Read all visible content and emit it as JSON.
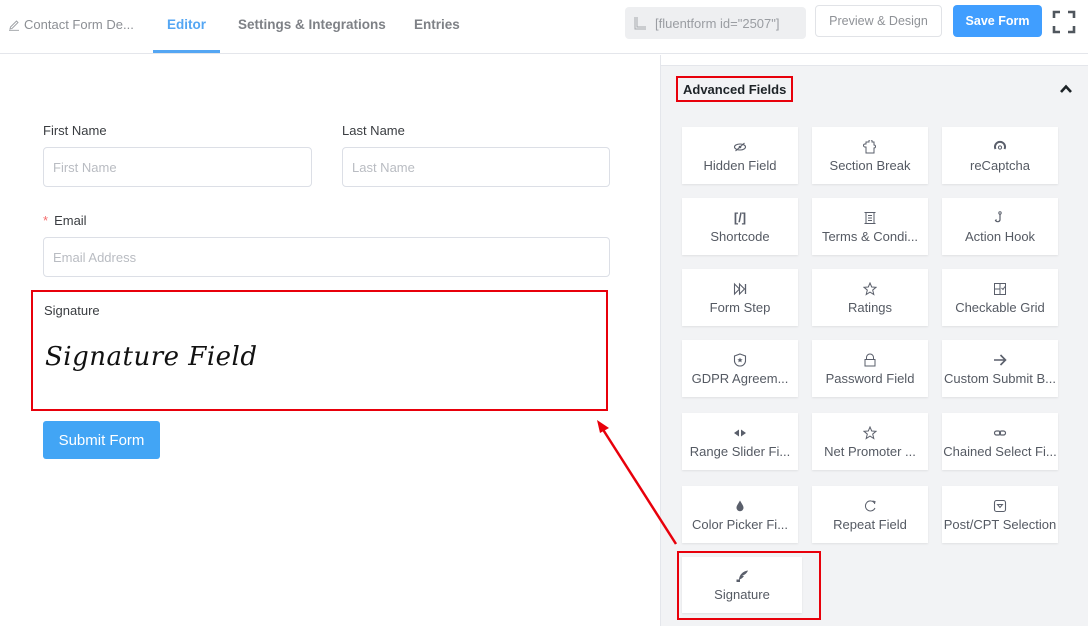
{
  "header": {
    "form_title": "Contact Form De...",
    "tabs": [
      {
        "label": "Editor",
        "active": true
      },
      {
        "label": "Settings & Integrations",
        "active": false
      },
      {
        "label": "Entries",
        "active": false
      }
    ],
    "shortcode": "[fluentform id=\"2507\"]",
    "preview_label": "Preview & Design",
    "save_label": "Save Form"
  },
  "form": {
    "first_name": {
      "label": "First Name",
      "placeholder": "First Name"
    },
    "last_name": {
      "label": "Last Name",
      "placeholder": "Last Name"
    },
    "email": {
      "required_mark": "*",
      "label": "Email",
      "placeholder": "Email Address"
    },
    "signature": {
      "label": "Signature",
      "preview_text": "Signature Field"
    },
    "submit_label": "Submit Form"
  },
  "sidebar": {
    "section_title": "Advanced Fields",
    "fields": [
      {
        "label": "Hidden Field",
        "icon": "eye-slash-icon"
      },
      {
        "label": "Section Break",
        "icon": "puzzle-icon"
      },
      {
        "label": "reCaptcha",
        "icon": "recaptcha-icon"
      },
      {
        "label": "Shortcode",
        "icon": "shortcode-icon"
      },
      {
        "label": "Terms & Condi...",
        "icon": "scroll-icon"
      },
      {
        "label": "Action Hook",
        "icon": "hook-icon"
      },
      {
        "label": "Form Step",
        "icon": "step-forward-icon"
      },
      {
        "label": "Ratings",
        "icon": "star-icon"
      },
      {
        "label": "Checkable Grid",
        "icon": "grid-check-icon"
      },
      {
        "label": "GDPR Agreem...",
        "icon": "shield-icon"
      },
      {
        "label": "Password Field",
        "icon": "lock-icon"
      },
      {
        "label": "Custom Submit B...",
        "icon": "arrow-right-icon"
      },
      {
        "label": "Range Slider Fi...",
        "icon": "range-arrows-icon"
      },
      {
        "label": "Net Promoter ...",
        "icon": "star-outline-icon"
      },
      {
        "label": "Chained Select Fi...",
        "icon": "link-icon"
      },
      {
        "label": "Color Picker Fi...",
        "icon": "droplet-icon"
      },
      {
        "label": "Repeat Field",
        "icon": "refresh-icon"
      },
      {
        "label": "Post/CPT Selection",
        "icon": "dropdown-box-icon"
      },
      {
        "label": "Signature",
        "icon": "quill-icon"
      }
    ]
  },
  "colors": {
    "accent": "#409eff",
    "highlight": "#e8000b"
  }
}
